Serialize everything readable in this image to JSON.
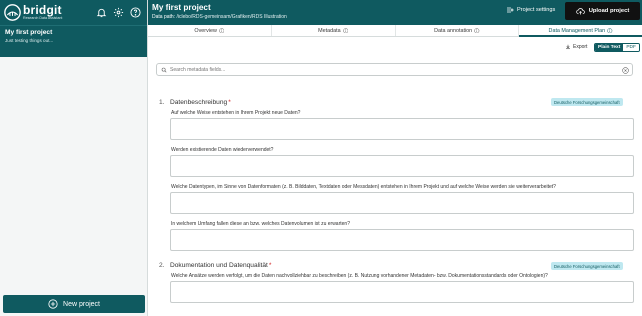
{
  "brand": {
    "name": "bridgit",
    "tagline": "Research Data Assistant"
  },
  "sidebar": {
    "project": {
      "title": "My first project",
      "description": "Just testing things out..."
    },
    "new_project_label": "New project"
  },
  "header": {
    "title": "My first project",
    "path_label": "Data path:",
    "path_value": "/iclebo/RDS-gemeinsam/Grafiken/RDS Illustration",
    "settings_label": "Project settings",
    "upload_label": "Upload project"
  },
  "tabs": [
    {
      "label": "Overview",
      "active": false
    },
    {
      "label": "Metadata",
      "active": false
    },
    {
      "label": "Data annotation",
      "active": false
    },
    {
      "label": "Data Management Plan",
      "active": true
    }
  ],
  "toolbar": {
    "export_label": "Export",
    "formats": [
      "Plain Text",
      "PDF"
    ],
    "selected_format": "Plain Text"
  },
  "search": {
    "placeholder": "Search metadata fields..."
  },
  "sections": [
    {
      "number": "1.",
      "title": "Datenbeschreibung",
      "badge": "Deutsche Forschungsgemeinschaft",
      "questions": [
        "Auf welche Weise entstehen in Ihrem Projekt neue Daten?",
        "Werden existierende Daten wiederverwendet?",
        "Welche Datentypen, im Sinne von Datenformaten (z. B. Bilddaten, Textdaten oder Messdaten) entstehen in Ihrem Projekt und auf welche Weise werden sie weiterverarbeitet?",
        "In welchem Umfang fallen diese an bzw. welches Datenvolumen ist zu erwarten?"
      ]
    },
    {
      "number": "2.",
      "title": "Dokumentation und Datenqualität",
      "badge": "Deutsche Forschungsgemeinschaft",
      "questions": [
        "Welche Ansätze werden verfolgt, um die Daten nachvollziehbar zu beschreiben (z. B. Nutzung vorhandener Metadaten- bzw. Dokumentationsstandards oder Ontologien)?"
      ]
    }
  ],
  "required_marker": "*",
  "colors": {
    "brand": "#0f5a60",
    "upload_button": "#111111",
    "badge_bg": "#bfe8f0",
    "required": "#d11a1a"
  },
  "icons": {
    "header": [
      "bell-icon",
      "gear-icon",
      "help-icon"
    ],
    "settings": "settings-list-icon",
    "upload": "upload-icon",
    "tab_info": "info-icon",
    "export": "download-icon",
    "search": "search-icon",
    "clear": "clear-icon",
    "new_project": "plus-circle-icon"
  }
}
